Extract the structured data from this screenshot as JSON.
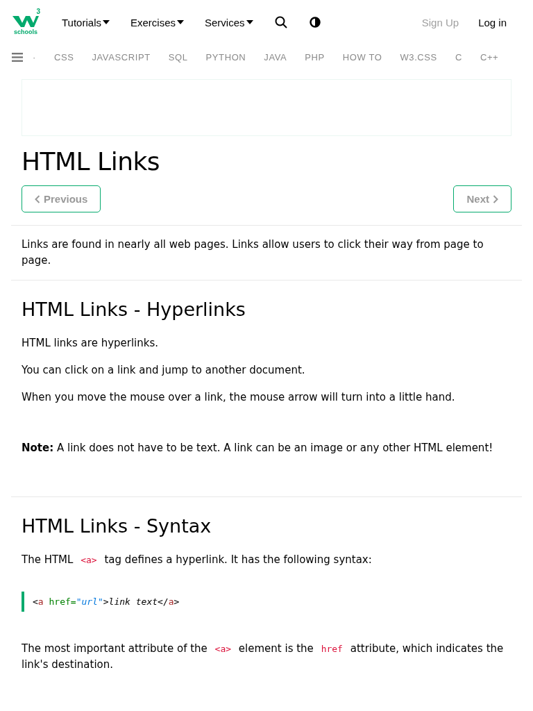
{
  "header": {
    "logo": {
      "mark": "3",
      "word": "schools"
    },
    "menus": [
      {
        "label": "Tutorials",
        "kind": "dropdown"
      },
      {
        "label": "Exercises",
        "kind": "dropdown"
      },
      {
        "label": "Services",
        "kind": "dropdown"
      },
      {
        "kind": "search"
      },
      {
        "kind": "contrast"
      }
    ],
    "auth": [
      {
        "label": "Sign Up",
        "dimmed": true
      },
      {
        "label": "Log in",
        "dimmed": false
      }
    ]
  },
  "subnav": [
    "·",
    "CSS",
    "JAVASCRIPT",
    "SQL",
    "PYTHON",
    "JAVA",
    "PHP",
    "HOW TO",
    "W3.CSS",
    "C",
    "C++"
  ],
  "page": {
    "title": "HTML Links",
    "pager": [
      {
        "label": "Previous",
        "kind": "prev"
      },
      {
        "label": "Next",
        "kind": "next"
      }
    ],
    "sections": [
      {
        "blocks": [
          {
            "kind": "para",
            "parts": [
              {
                "kind": "text",
                "text": "Links are found in nearly all web pages. Links allow users to click their way from page to page."
              }
            ]
          }
        ]
      },
      {
        "heading": "HTML Links - Hyperlinks",
        "blocks": [
          {
            "kind": "para",
            "parts": [
              {
                "kind": "text",
                "text": "HTML links are hyperlinks."
              }
            ]
          },
          {
            "kind": "para",
            "parts": [
              {
                "kind": "text",
                "text": "You can click on a link and jump to another document."
              }
            ]
          },
          {
            "kind": "para",
            "parts": [
              {
                "kind": "text",
                "text": "When you move the mouse over a link, the mouse arrow will turn into a little hand."
              }
            ]
          },
          {
            "kind": "note",
            "parts": [
              {
                "kind": "text",
                "text": "**Note:** A link does not have to be text. A link can be an image or any other HTML element!"
              }
            ]
          }
        ]
      },
      {
        "heading": "HTML Links - Syntax",
        "blocks": [
          {
            "kind": "para",
            "parts": [
              {
                "kind": "text",
                "text": "The HTML "
              },
              {
                "kind": "code",
                "text": "<a>"
              },
              {
                "kind": "text",
                "text": " tag defines a hyperlink. It has the following syntax:"
              }
            ]
          },
          {
            "kind": "example",
            "parts": [
              {
                "kind": "punct",
                "text": "<"
              },
              {
                "kind": "tag",
                "text": "a"
              },
              {
                "kind": "attr",
                "text": " href="
              },
              {
                "kind": "value",
                "text": "\""
              },
              {
                "kind": "valueit",
                "text": "url"
              },
              {
                "kind": "value",
                "text": "\""
              },
              {
                "kind": "punct",
                "text": ">"
              },
              {
                "kind": "textit",
                "text": "link text"
              },
              {
                "kind": "punct",
                "text": "</"
              },
              {
                "kind": "tag",
                "text": "a"
              },
              {
                "kind": "punct",
                "text": ">"
              }
            ]
          },
          {
            "kind": "para",
            "parts": [
              {
                "kind": "text",
                "text": "The most important attribute of the "
              },
              {
                "kind": "code",
                "text": "<a>"
              },
              {
                "kind": "text",
                "text": " element is the "
              },
              {
                "kind": "code",
                "text": "href"
              },
              {
                "kind": "text",
                "text": " attribute, which indicates the link's destination."
              }
            ]
          }
        ]
      }
    ]
  }
}
